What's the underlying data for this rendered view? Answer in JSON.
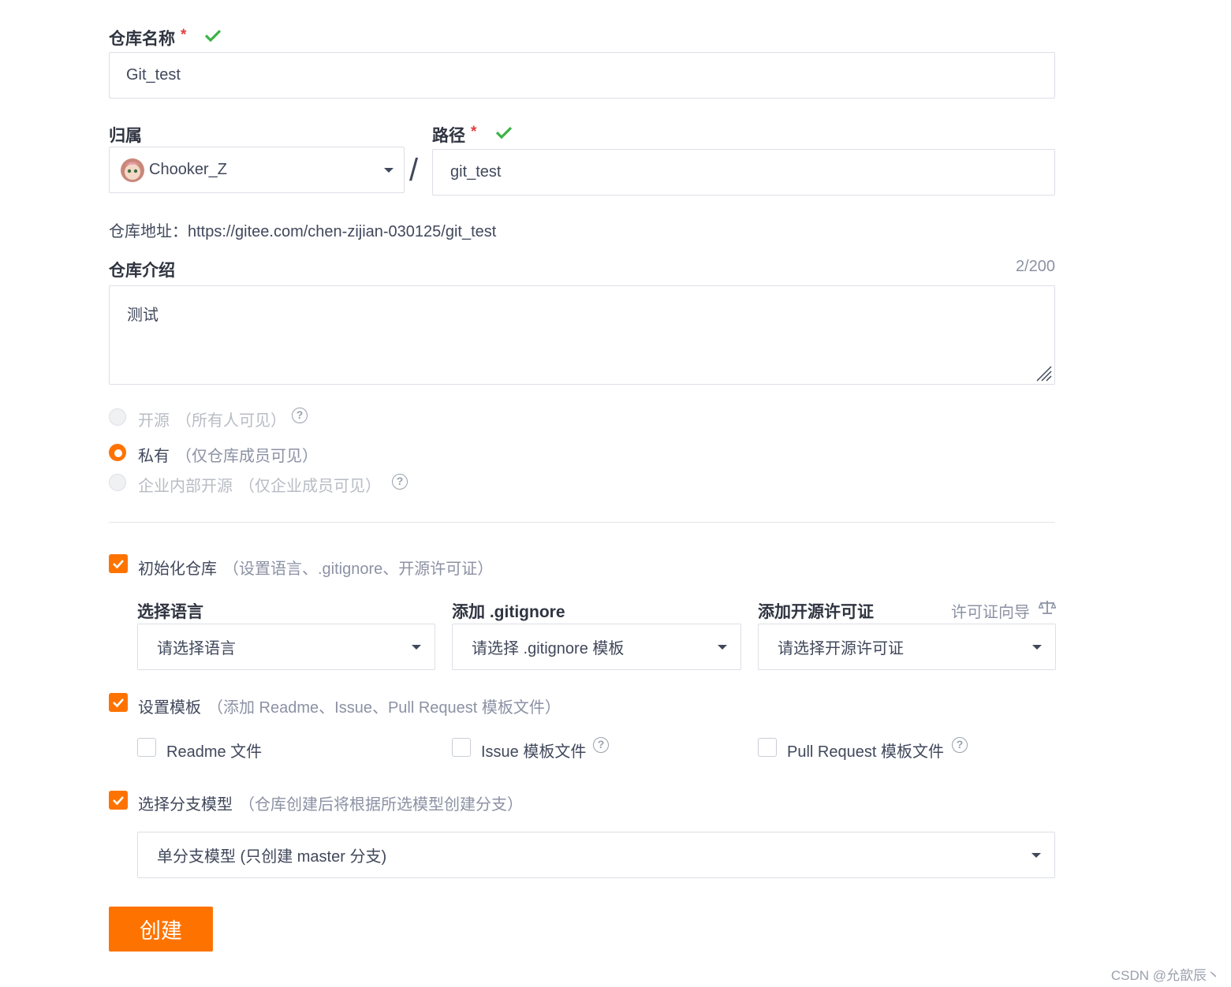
{
  "repo_name": {
    "label": "仓库名称",
    "required_mark": "*",
    "value": "Git_test"
  },
  "owner": {
    "label": "归属",
    "value": "Chooker_Z"
  },
  "path_separator": "/",
  "path": {
    "label": "路径",
    "required_mark": "*",
    "value": "git_test"
  },
  "repo_address": {
    "label": "仓库地址：",
    "url": "https://gitee.com/chen-zijian-030125/git_test"
  },
  "description": {
    "label": "仓库介绍",
    "counter": "2/200",
    "value": "测试"
  },
  "visibility": {
    "options": [
      {
        "label": "开源",
        "hint": "（所有人可见）",
        "state": "disabled"
      },
      {
        "label": "私有",
        "hint": "（仅仓库成员可见）",
        "state": "selected"
      },
      {
        "label": "企业内部开源",
        "hint": "（仅企业成员可见）",
        "state": "disabled"
      }
    ]
  },
  "init_repo": {
    "label": "初始化仓库",
    "hint": "（设置语言、.gitignore、开源许可证）",
    "checked": true
  },
  "language": {
    "label": "选择语言",
    "placeholder": "请选择语言"
  },
  "gitignore": {
    "label": "添加 .gitignore",
    "placeholder": "请选择 .gitignore 模板"
  },
  "license": {
    "label": "添加开源许可证",
    "wizard_link": "许可证向导",
    "placeholder": "请选择开源许可证"
  },
  "templates": {
    "label": "设置模板",
    "hint": "（添加 Readme、Issue、Pull Request 模板文件）",
    "checked": true,
    "items": [
      {
        "label": "Readme 文件",
        "checked": false
      },
      {
        "label": "Issue 模板文件",
        "checked": false
      },
      {
        "label": "Pull Request 模板文件",
        "checked": false
      }
    ]
  },
  "branch_model": {
    "label": "选择分支模型",
    "hint": "（仓库创建后将根据所选模型创建分支）",
    "checked": true,
    "value": "单分支模型 (只创建 master 分支)"
  },
  "create_button": "创建",
  "watermark": "CSDN @允歆辰丶",
  "colors": {
    "accent": "#fe7300",
    "success": "#3bb346",
    "required": "#e43c3c"
  }
}
